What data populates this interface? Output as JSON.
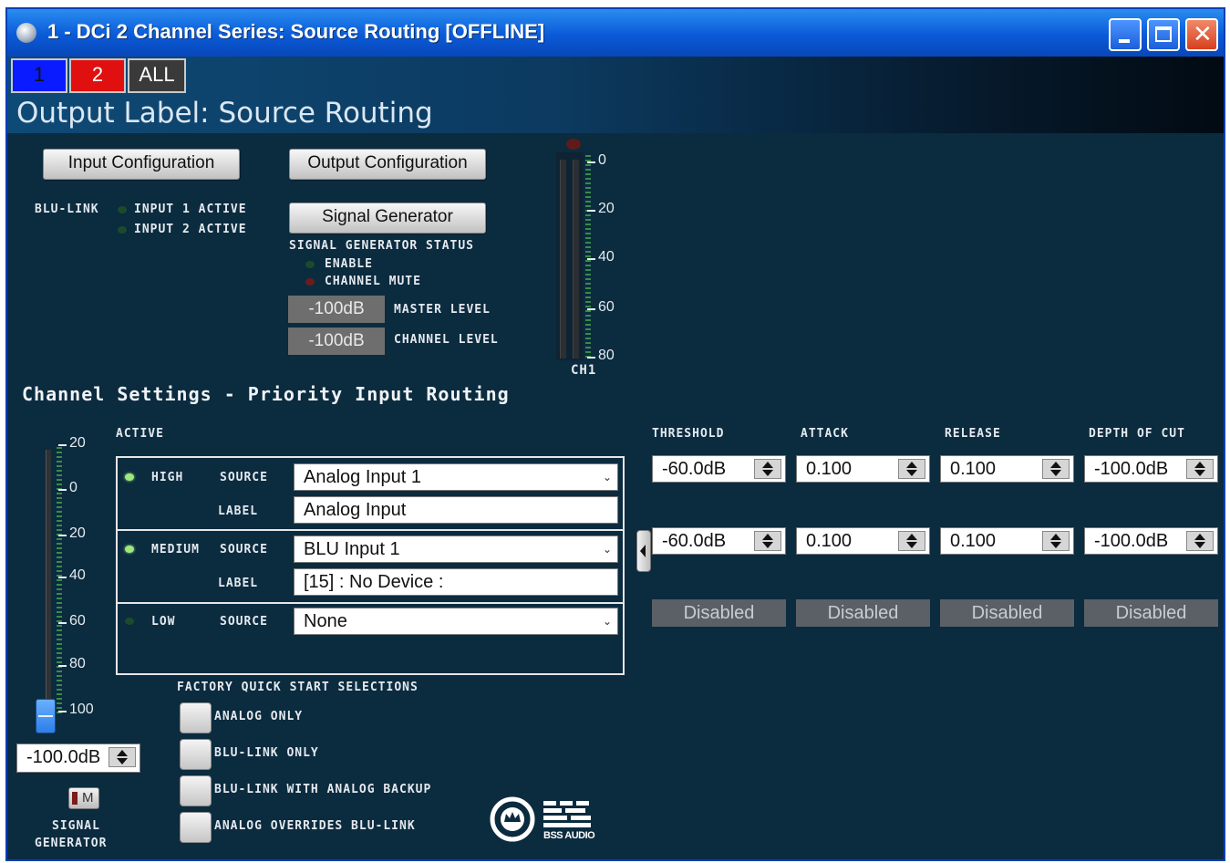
{
  "window": {
    "title": "1 - DCi 2 Channel Series: Source Routing [OFFLINE]"
  },
  "channel_tabs": [
    {
      "label": "1",
      "color": "#0a1cff"
    },
    {
      "label": "2",
      "color": "#e01010"
    },
    {
      "label": "ALL",
      "color": "#3a3a3a"
    }
  ],
  "header": {
    "output_label": "Output Label: Source Routing"
  },
  "config": {
    "input_configuration": "Input Configuration",
    "output_configuration": "Output Configuration",
    "signal_generator": "Signal Generator",
    "blu_link": "BLU-LINK",
    "input1_active": "INPUT 1 ACTIVE",
    "input2_active": "INPUT 2 ACTIVE",
    "sg_status": "SIGNAL GENERATOR STATUS",
    "enable": "ENABLE",
    "channel_mute": "CHANNEL MUTE",
    "master_level_value": "-100dB",
    "master_level": "MASTER LEVEL",
    "channel_level_value": "-100dB",
    "channel_level": "CHANNEL LEVEL"
  },
  "meter": {
    "scale": [
      "0",
      "20",
      "40",
      "60",
      "80"
    ],
    "label": "CH1"
  },
  "channel_settings": {
    "title": "Channel Settings - Priority Input Routing",
    "active": "ACTIVE",
    "source": "SOURCE",
    "label": "LABEL",
    "rows": [
      {
        "priority": "HIGH",
        "source": "Analog Input 1",
        "label": "Analog Input",
        "active": true
      },
      {
        "priority": "MEDIUM",
        "source": "BLU Input 1",
        "label": "[15] : No Device :",
        "active": true
      },
      {
        "priority": "LOW",
        "source": "None",
        "active": false
      }
    ]
  },
  "dynamics": {
    "headers": [
      "THRESHOLD",
      "ATTACK",
      "RELEASE",
      "DEPTH OF CUT"
    ],
    "row1": [
      "-60.0dB",
      "0.100",
      "0.100",
      "-100.0dB"
    ],
    "row2": [
      "-60.0dB",
      "0.100",
      "0.100",
      "-100.0dB"
    ],
    "row3": [
      "Disabled",
      "Disabled",
      "Disabled",
      "Disabled"
    ]
  },
  "fader": {
    "scale": [
      "20",
      "0",
      "20",
      "40",
      "60",
      "80",
      "100"
    ],
    "value": "-100.0dB",
    "mute": "M",
    "label_line1": "SIGNAL",
    "label_line2": "GENERATOR"
  },
  "quick_start": {
    "title": "FACTORY QUICK START SELECTIONS",
    "options": [
      "ANALOG ONLY",
      "BLU-LINK ONLY",
      "BLU-LINK WITH ANALOG BACKUP",
      "ANALOG OVERRIDES BLU-LINK"
    ]
  },
  "logo": {
    "text": "BSS AUDIO"
  }
}
